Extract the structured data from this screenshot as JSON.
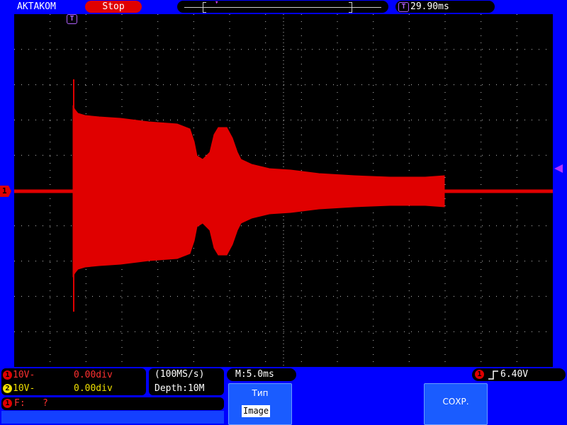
{
  "header": {
    "brand": "AKTAKOM",
    "run_state": "Stop",
    "memory_trigger_marker": "T",
    "trigger_position": "29.90ms"
  },
  "screen": {
    "ch1_marker": "1",
    "trigger_marker": "T",
    "trace_color": "#e00000",
    "grid_color": "#c0c0c0"
  },
  "channels": [
    {
      "id": "1",
      "volts_div": "10V-",
      "position": "0.00div",
      "color": "#ff3030"
    },
    {
      "id": "2",
      "volts_div": "10V-",
      "position": "0.00div",
      "color": "#f0e000"
    }
  ],
  "acquisition": {
    "sample_rate": "(100MS/s)",
    "depth": "Depth:10M"
  },
  "timebase": {
    "value": "M:5.0ms"
  },
  "trigger": {
    "channel": "1",
    "level": "6.40V"
  },
  "frequency": {
    "channel": "1",
    "label": "F:",
    "value": "?"
  },
  "softkeys": {
    "type_label": "Тип",
    "type_value": "Image",
    "save_label": "СОХР."
  }
}
